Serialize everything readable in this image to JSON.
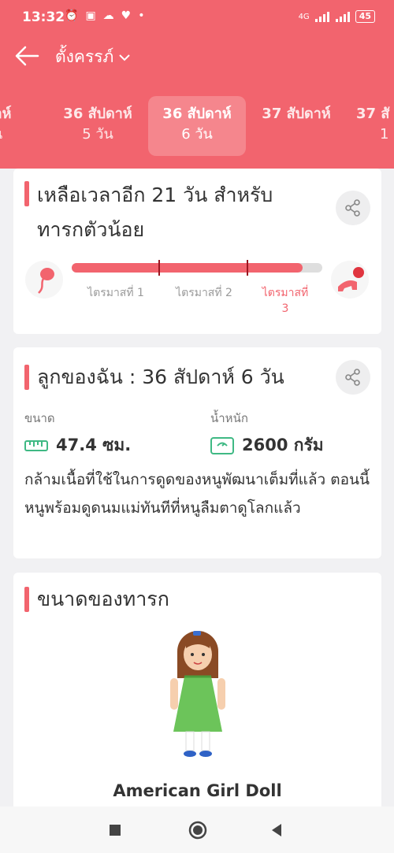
{
  "status_bar": {
    "time": "13:32",
    "battery": "45",
    "network": "4G"
  },
  "header": {
    "title": "ตั้งครรภ์"
  },
  "tabs": [
    {
      "line1": "ปดาห์",
      "line2": "วัน"
    },
    {
      "line1": "36 สัปดาห์",
      "line2": "5 วัน"
    },
    {
      "line1": "36 สัปดาห์",
      "line2": "6 วัน"
    },
    {
      "line1": "37 สัปดาห์",
      "line2": ""
    },
    {
      "line1": "37 สั",
      "line2": "1"
    }
  ],
  "countdown": {
    "title_line1": "เหลือเวลาอีก 21 วัน สำหรับ",
    "title_line2": "ทารกตัวน้อย",
    "progress_percent": 92,
    "trimesters": [
      "ไตรมาสที่ 1",
      "ไตรมาสที่ 2",
      "ไตรมาสที่"
    ],
    "trimester3_line2": "3"
  },
  "baby": {
    "title": "ลูกของฉัน : 36 สัปดาห์ 6  วัน",
    "size_label": "ขนาด",
    "size_value": "47.4 ซม.",
    "weight_label": "น้ำหนัก",
    "weight_value": "2600 กรัม",
    "description": "กล้ามเนื้อที่ใช้ในการดูดของหนูพัฒนาเต็มที่แล้ว ตอนนี้หนูพร้อมดูดนมแม่ทันทีที่หนูลืมตาดูโลกแล้ว"
  },
  "size_card": {
    "title": "ขนาดของทารก",
    "comparison": "American Girl Doll"
  },
  "colors": {
    "accent": "#f2646e",
    "background": "#f1f1f3"
  }
}
